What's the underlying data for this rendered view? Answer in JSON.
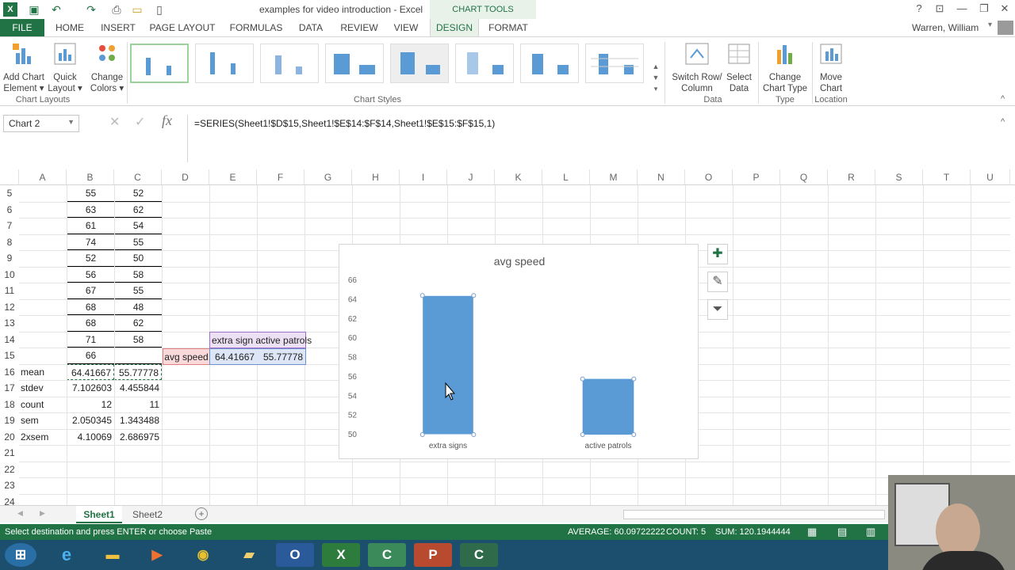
{
  "window": {
    "title": "examples for video introduction - Excel",
    "context_tab": "CHART TOOLS",
    "user": "Warren, William"
  },
  "tabs": [
    "FILE",
    "HOME",
    "INSERT",
    "PAGE LAYOUT",
    "FORMULAS",
    "DATA",
    "REVIEW",
    "VIEW",
    "DESIGN",
    "FORMAT"
  ],
  "ribbon": {
    "add_chart_element": [
      "Add Chart",
      "Element ▾"
    ],
    "quick_layout": [
      "Quick",
      "Layout ▾"
    ],
    "change_colors": [
      "Change",
      "Colors ▾"
    ],
    "switch_row_col": [
      "Switch Row/",
      "Column"
    ],
    "select_data": [
      "Select",
      "Data"
    ],
    "change_chart_type": [
      "Change",
      "Chart Type"
    ],
    "move_chart": [
      "Move",
      "Chart"
    ],
    "groups": {
      "chart_layouts": "Chart Layouts",
      "chart_styles": "Chart Styles",
      "data": "Data",
      "type": "Type",
      "location": "Location"
    }
  },
  "formula_bar": {
    "name_box": "Chart 2",
    "formula": "=SERIES(Sheet1!$D$15,Sheet1!$E$14:$F$14,Sheet1!$E$15:$F$15,1)"
  },
  "columns": [
    "A",
    "B",
    "C",
    "D",
    "E",
    "F",
    "G",
    "H",
    "I",
    "J",
    "K",
    "L",
    "M",
    "N",
    "O",
    "P",
    "Q",
    "R",
    "S",
    "T",
    "U"
  ],
  "rows": [
    {
      "n": "5",
      "a": "",
      "b": "55",
      "c": "52"
    },
    {
      "n": "6",
      "a": "",
      "b": "63",
      "c": "62"
    },
    {
      "n": "7",
      "a": "",
      "b": "61",
      "c": "54"
    },
    {
      "n": "8",
      "a": "",
      "b": "74",
      "c": "55"
    },
    {
      "n": "9",
      "a": "",
      "b": "52",
      "c": "50"
    },
    {
      "n": "10",
      "a": "",
      "b": "56",
      "c": "58"
    },
    {
      "n": "11",
      "a": "",
      "b": "67",
      "c": "55"
    },
    {
      "n": "12",
      "a": "",
      "b": "68",
      "c": "48"
    },
    {
      "n": "13",
      "a": "",
      "b": "68",
      "c": "62"
    },
    {
      "n": "14",
      "a": "",
      "b": "71",
      "c": "58"
    },
    {
      "n": "15",
      "a": "",
      "b": "66",
      "c": ""
    },
    {
      "n": "16",
      "a": "mean",
      "b": "64.41667",
      "c": "55.77778"
    },
    {
      "n": "17",
      "a": "stdev",
      "b": "7.102603",
      "c": "4.455844"
    },
    {
      "n": "18",
      "a": "count",
      "b": "12",
      "c": "11"
    },
    {
      "n": "19",
      "a": "sem",
      "b": "2.050345",
      "c": "1.343488"
    },
    {
      "n": "20",
      "a": "2xsem",
      "b": "4.10069",
      "c": "2.686975"
    },
    {
      "n": "21",
      "a": "",
      "b": "",
      "c": ""
    },
    {
      "n": "22",
      "a": "",
      "b": "",
      "c": ""
    },
    {
      "n": "23",
      "a": "",
      "b": "",
      "c": ""
    },
    {
      "n": "24",
      "a": "",
      "b": "",
      "c": ""
    }
  ],
  "series_cells": {
    "d15": "avg speed",
    "e14": "extra sign",
    "f14": "active patrols",
    "e15": "64.41667",
    "f15": "55.77778"
  },
  "chart_data": {
    "type": "bar",
    "title": "avg speed",
    "categories": [
      "extra signs",
      "active patrols"
    ],
    "values": [
      64.41667,
      55.77778
    ],
    "ylim": [
      50,
      66
    ],
    "yticks": [
      "50",
      "52",
      "54",
      "56",
      "58",
      "60",
      "62",
      "64",
      "66"
    ],
    "grid": false,
    "color": "#5b9bd5"
  },
  "sheets": [
    "Sheet1",
    "Sheet2"
  ],
  "status": {
    "message": "Select destination and press ENTER or choose Paste",
    "average": "AVERAGE: 60.09722222",
    "count": "COUNT: 5",
    "sum": "SUM: 120.1944444"
  },
  "colors": {
    "excel_green": "#217346",
    "bar": "#5b9bd5"
  }
}
